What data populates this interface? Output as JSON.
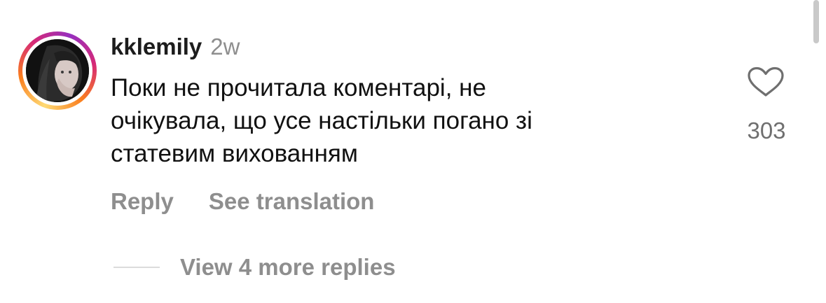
{
  "comment": {
    "username": "kklemily",
    "time": "2w",
    "text_lines": [
      "Поки не прочитала коментарі, не",
      "очікувала, що усе настільки погано зі",
      "статевим вихованням"
    ],
    "likes": "303"
  },
  "actions": {
    "reply": "Reply",
    "see_translation": "See translation"
  },
  "replies": {
    "view_more": "View 4 more replies"
  },
  "icons": {
    "like": "heart-outline-icon",
    "avatar": "profile-photo"
  },
  "colors": {
    "text": "#111111",
    "muted": "#8e8e8e",
    "ring_start": "#feda75",
    "ring_end": "#d62976"
  }
}
